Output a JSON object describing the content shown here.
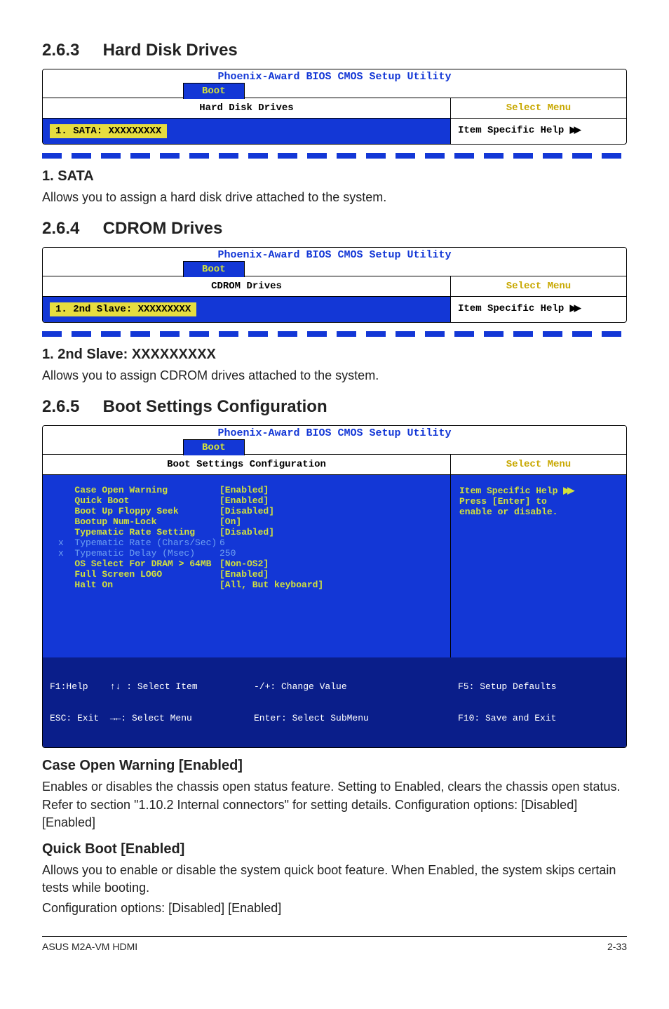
{
  "sections": {
    "s263": {
      "num": "2.6.3",
      "title": "Hard Disk Drives"
    },
    "s264": {
      "num": "2.6.4",
      "title": "CDROM Drives"
    },
    "s265": {
      "num": "2.6.5",
      "title": "Boot Settings Configuration"
    }
  },
  "bios_common": {
    "title": "Phoenix-Award BIOS CMOS Setup Utility",
    "tab": "Boot",
    "select_menu": "Select Menu",
    "item_help": "Item Specific Help ",
    "ff": "▶▶"
  },
  "bios1": {
    "panel_title": "Hard Disk Drives",
    "selected": "1. SATA: XXXXXXXXX"
  },
  "sata": {
    "heading": "1. SATA",
    "text": "Allows you to assign a hard disk drive attached to the system."
  },
  "bios2": {
    "panel_title": "CDROM Drives",
    "selected": "1. 2nd Slave: XXXXXXXXX"
  },
  "slave": {
    "heading": "1. 2nd Slave: XXXXXXXXX",
    "text": "Allows you to assign CDROM drives attached to the system."
  },
  "bios3": {
    "panel_title": "Boot Settings Configuration",
    "right_lines": [
      "Item Specific Help ",
      "Press [Enter] to",
      "enable or disable."
    ],
    "rows": [
      {
        "k": "Case Open Warning",
        "v": "[Enabled]",
        "dim": false
      },
      {
        "k": "Quick Boot",
        "v": "[Enabled]",
        "dim": false
      },
      {
        "k": "Boot Up Floppy Seek",
        "v": "[Disabled]",
        "dim": false
      },
      {
        "k": "Bootup Num-Lock",
        "v": "[On]",
        "dim": false
      },
      {
        "k": "Typematic Rate Setting",
        "v": "[Disabled]",
        "dim": false
      },
      {
        "k": "Typematic Rate (Chars/Sec)",
        "v": " 6",
        "dim": true,
        "prefix": "x  "
      },
      {
        "k": "Typematic Delay (Msec)",
        "v": " 250",
        "dim": true,
        "prefix": "x  "
      },
      {
        "k": "OS Select For DRAM > 64MB",
        "v": "[Non-OS2]",
        "dim": false
      },
      {
        "k": "Full Screen LOGO",
        "v": "[Enabled]",
        "dim": false
      },
      {
        "k": "Halt On",
        "v": "[All, But keyboard]",
        "dim": false
      }
    ],
    "footer": {
      "c1": "F1:Help    ↑↓ : Select Item",
      "c1b": "ESC: Exit  →←: Select Menu",
      "c2": "-/+: Change Value",
      "c2b": "Enter: Select SubMenu",
      "c3": "F5: Setup Defaults",
      "c3b": "F10: Save and Exit"
    }
  },
  "case_open": {
    "heading": "Case Open Warning [Enabled]",
    "text": "Enables or disables the chassis open status feature. Setting to Enabled, clears the chassis open status. Refer to section \"1.10.2 Internal connectors\" for setting details. Configuration options: [Disabled] [Enabled]"
  },
  "quick_boot": {
    "heading": "Quick Boot [Enabled]",
    "text1": "Allows you to enable or disable the system quick boot feature. When Enabled, the system skips certain tests while booting.",
    "text2": "Configuration options: [Disabled] [Enabled]"
  },
  "footer": {
    "left": "ASUS M2A-VM HDMI",
    "right": "2-33"
  }
}
